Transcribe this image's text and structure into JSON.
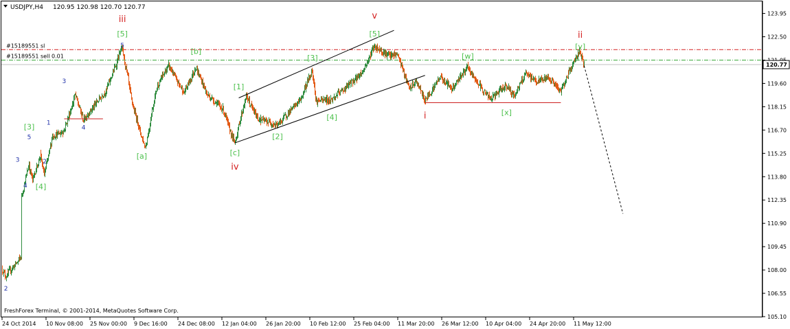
{
  "window": {
    "title": "USDJPY,H4",
    "ohlc": "120.95 120.98 120.70 120.77",
    "copyright": "FreshForex Terminal, © 2001-2014, MetaQuotes Software Corp."
  },
  "orders": {
    "sl_label": "#15189551 sl",
    "sell_label": "#15189551 sell 0.01",
    "sl_price": 121.7,
    "entry_price": 121.05
  },
  "colors": {
    "bull": "#2e8b3e",
    "bear": "#e35a16",
    "wave_red": "#d42020",
    "wave_green": "#4cc04c",
    "wave_blue": "#2233aa",
    "grid": "#c8c8c8"
  },
  "chart_data": {
    "type": "candlestick",
    "symbol": "USDJPY",
    "timeframe": "H4",
    "current_price": 120.77,
    "ylim": [
      105.1,
      124.7
    ],
    "y_ticks": [
      "123.95",
      "122.50",
      "121.05",
      "119.60",
      "118.15",
      "116.70",
      "115.25",
      "113.80",
      "112.35",
      "110.90",
      "109.45",
      "108.00",
      "106.55",
      "105.10"
    ],
    "x_ticks": [
      "24 Oct 2014",
      "10 Nov 08:00",
      "25 Nov 00:00",
      "9 Dec 16:00",
      "24 Dec 08:00",
      "12 Jan 04:00",
      "26 Jan 20:00",
      "10 Feb 12:00",
      "25 Feb 04:00",
      "11 Mar 20:00",
      "26 Mar 12:00",
      "10 Apr 04:00",
      "24 Apr 20:00",
      "11 May 12:00"
    ],
    "price_path": [
      {
        "x": "24 Oct 2014",
        "y": 108.1
      },
      {
        "x": "27 Oct 2014",
        "y": 107.6
      },
      {
        "x": "31 Oct 2014",
        "y": 108.8
      },
      {
        "x": "31 Oct 2014",
        "y": 112.4
      },
      {
        "x": "4 Nov 2014",
        "y": 114.6
      },
      {
        "x": "5 Nov 2014",
        "y": 113.6
      },
      {
        "x": "7 Nov 2014",
        "y": 115.2
      },
      {
        "x": "10 Nov 2014",
        "y": 113.9
      },
      {
        "x": "12 Nov 2014",
        "y": 116.3
      },
      {
        "x": "17 Nov 2014",
        "y": 116.6
      },
      {
        "x": "20 Nov 2014",
        "y": 118.9
      },
      {
        "x": "24 Nov 2014",
        "y": 117.3
      },
      {
        "x": "2 Dec 2014",
        "y": 119.2
      },
      {
        "x": "8 Dec 2014",
        "y": 121.8
      },
      {
        "x": "11 Dec 2014",
        "y": 118.0
      },
      {
        "x": "16 Dec 2014",
        "y": 115.6
      },
      {
        "x": "19 Dec 2014",
        "y": 119.4
      },
      {
        "x": "24 Dec 2014",
        "y": 120.7
      },
      {
        "x": "30 Dec 2014",
        "y": 119.0
      },
      {
        "x": "2 Jan 2015",
        "y": 120.6
      },
      {
        "x": "7 Jan 2015",
        "y": 118.9
      },
      {
        "x": "13 Jan 2015",
        "y": 118.0
      },
      {
        "x": "16 Jan 2015",
        "y": 115.9
      },
      {
        "x": "21 Jan 2015",
        "y": 118.8
      },
      {
        "x": "26 Jan 2015",
        "y": 117.4
      },
      {
        "x": "2 Feb 2015",
        "y": 117.0
      },
      {
        "x": "10 Feb 2015",
        "y": 118.6
      },
      {
        "x": "13 Feb 2015",
        "y": 120.4
      },
      {
        "x": "16 Feb 2015",
        "y": 118.5
      },
      {
        "x": "20 Feb 2015",
        "y": 118.6
      },
      {
        "x": "26 Feb 2015",
        "y": 119.4
      },
      {
        "x": "4 Mar 2015",
        "y": 120.3
      },
      {
        "x": "9 Mar 2015",
        "y": 121.9
      },
      {
        "x": "13 Mar 2015",
        "y": 121.3
      },
      {
        "x": "17 Mar 2015",
        "y": 121.4
      },
      {
        "x": "20 Mar 2015",
        "y": 119.3
      },
      {
        "x": "24 Mar 2015",
        "y": 119.7
      },
      {
        "x": "26 Mar 2015",
        "y": 118.5
      },
      {
        "x": "1 Apr 2015",
        "y": 120.0
      },
      {
        "x": "6 Apr 2015",
        "y": 119.3
      },
      {
        "x": "10 Apr 2015",
        "y": 120.6
      },
      {
        "x": "15 Apr 2015",
        "y": 119.5
      },
      {
        "x": "20 Apr 2015",
        "y": 118.6
      },
      {
        "x": "24 Apr 2015",
        "y": 119.5
      },
      {
        "x": "28 Apr 2015",
        "y": 118.8
      },
      {
        "x": "1 May 2015",
        "y": 120.2
      },
      {
        "x": "6 May 2015",
        "y": 119.7
      },
      {
        "x": "11 May 2015",
        "y": 120.0
      },
      {
        "x": "14 May 2015",
        "y": 119.1
      },
      {
        "x": "18 May 2015",
        "y": 120.2
      },
      {
        "x": "21 May 2015",
        "y": 121.7
      },
      {
        "x": "22 May 2015",
        "y": 120.77
      }
    ],
    "wave_labels": [
      {
        "text": "2",
        "color": "blue",
        "x": "27 Oct 2014",
        "y": 106.9
      },
      {
        "text": "3",
        "color": "blue",
        "x": "30 Oct 2014",
        "y": 114.9
      },
      {
        "text": "4",
        "color": "blue",
        "x": "2 Nov 2014",
        "y": 113.3
      },
      {
        "text": "5",
        "color": "blue",
        "x": "4 Nov 2014",
        "y": 116.3
      },
      {
        "text": "[3]",
        "color": "green",
        "x": "4 Nov 2014",
        "y": 116.9
      },
      {
        "text": "2",
        "color": "blue",
        "x": "10 Nov 2014",
        "y": 114.8
      },
      {
        "text": "[4]",
        "color": "green",
        "x": "7 Nov 2014",
        "y": 113.2
      },
      {
        "text": "1",
        "color": "blue",
        "x": "11 Nov 2014",
        "y": 117.2
      },
      {
        "text": "3",
        "color": "blue",
        "x": "17 Nov 2014",
        "y": 119.8
      },
      {
        "text": "4",
        "color": "blue",
        "x": "24 Nov 2014",
        "y": 116.9
      },
      {
        "text": "5",
        "color": "blue",
        "x": "8 Dec 2014",
        "y": 122.0
      },
      {
        "text": "[5]",
        "color": "green",
        "x": "7 Dec 2014",
        "y": 122.7
      },
      {
        "text": "iii",
        "color": "red",
        "x": "7 Dec 2014",
        "y": 123.6
      },
      {
        "text": "[a]",
        "color": "green",
        "x": "15 Dec 2014",
        "y": 115.1
      },
      {
        "text": "[b]",
        "color": "green",
        "x": "2 Jan 2015",
        "y": 121.6
      },
      {
        "text": "[c]",
        "color": "green",
        "x": "16 Jan 2015",
        "y": 115.3
      },
      {
        "text": "iv",
        "color": "red",
        "x": "16 Jan 2015",
        "y": 114.4
      },
      {
        "text": "[1]",
        "color": "green",
        "x": "18 Jan 2015",
        "y": 119.4
      },
      {
        "text": "[2]",
        "color": "green",
        "x": "2 Feb 2015",
        "y": 116.3
      },
      {
        "text": "[3]",
        "color": "green",
        "x": "13 Feb 2015",
        "y": 121.2
      },
      {
        "text": "[4]",
        "color": "green",
        "x": "20 Feb 2015",
        "y": 117.5
      },
      {
        "text": "[5]",
        "color": "green",
        "x": "9 Mar 2015",
        "y": 122.7
      },
      {
        "text": "v",
        "color": "red",
        "x": "9 Mar 2015",
        "y": 123.8
      },
      {
        "text": "i",
        "color": "red",
        "x": "26 Mar 2015",
        "y": 117.6
      },
      {
        "text": "[w]",
        "color": "green",
        "x": "10 Apr 2015",
        "y": 121.3
      },
      {
        "text": "[x]",
        "color": "green",
        "x": "24 Apr 2015",
        "y": 117.8
      },
      {
        "text": "[y]",
        "color": "green",
        "x": "21 May 2015",
        "y": 121.9
      },
      {
        "text": "ii",
        "color": "red",
        "x": "21 May 2015",
        "y": 122.6
      }
    ],
    "trend_lines": [
      {
        "name": "upper-channel",
        "from": {
          "x": "17 Jan 2015",
          "y": 118.7
        },
        "to": {
          "x": "16 Mar 2015",
          "y": 122.9
        }
      },
      {
        "name": "lower-channel",
        "from": {
          "x": "16 Jan 2015",
          "y": 115.9
        },
        "to": {
          "x": "26 Mar 2015",
          "y": 120.1
        }
      },
      {
        "name": "support-4",
        "from": {
          "x": "17 Nov 2014",
          "y": 117.4
        },
        "to": {
          "x": "30 Nov 2014",
          "y": 117.4
        }
      },
      {
        "name": "support-x",
        "from": {
          "x": "26 Mar 2015",
          "y": 118.4
        },
        "to": {
          "x": "14 May 2015",
          "y": 118.4
        }
      },
      {
        "name": "projection",
        "from": {
          "x": "22 May 2015",
          "y": 120.7
        },
        "to": {
          "x": "5 Jun 2015",
          "y": 111.5
        }
      }
    ],
    "grid": false
  }
}
